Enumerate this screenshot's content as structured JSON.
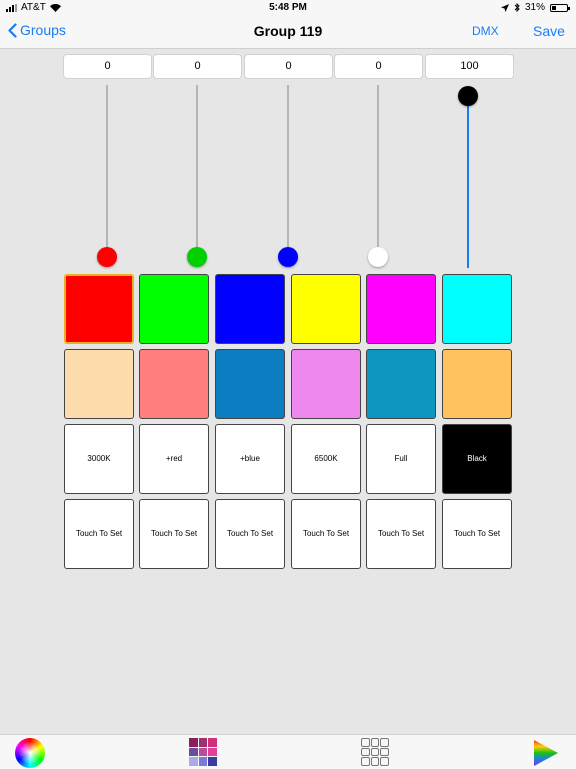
{
  "status_bar": {
    "carrier": "AT&T",
    "time": "5:48 PM",
    "battery": "31%",
    "battery_level": 0.31
  },
  "nav": {
    "back_label": "Groups",
    "title": "Group 119",
    "dmx_label": "DMX",
    "save_label": "Save"
  },
  "channels": [
    {
      "value": "0",
      "level": 0,
      "knob_color": "#ff0000"
    },
    {
      "value": "0",
      "level": 0,
      "knob_color": "#00d000"
    },
    {
      "value": "0",
      "level": 0,
      "knob_color": "#0000ff"
    },
    {
      "value": "0",
      "level": 0,
      "knob_color": "#ffffff"
    },
    {
      "value": "100",
      "level": 1,
      "knob_color": "#000000"
    }
  ],
  "color_swatches_row1": [
    {
      "color": "#ff0000",
      "selected": true
    },
    {
      "color": "#00ff00",
      "selected": false
    },
    {
      "color": "#0000ff",
      "selected": false
    },
    {
      "color": "#ffff00",
      "selected": false
    },
    {
      "color": "#ff00ff",
      "selected": false
    },
    {
      "color": "#00ffff",
      "selected": false
    }
  ],
  "color_swatches_row2": [
    {
      "color": "#ffdcac"
    },
    {
      "color": "#ff7f7f"
    },
    {
      "color": "#0b7dc0"
    },
    {
      "color": "#ee88ee"
    },
    {
      "color": "#0d96bf"
    },
    {
      "color": "#ffc25c"
    }
  ],
  "presets": [
    {
      "label": "3000K",
      "color": "#ffffff"
    },
    {
      "label": "+red",
      "color": "#ffffff"
    },
    {
      "label": "+blue",
      "color": "#ffffff"
    },
    {
      "label": "6500K",
      "color": "#ffffff"
    },
    {
      "label": "Full",
      "color": "#ffffff"
    },
    {
      "label": "Black",
      "color": "#000000"
    }
  ],
  "touch_to_set": [
    {
      "label": "Touch To Set"
    },
    {
      "label": "Touch To Set"
    },
    {
      "label": "Touch To Set"
    },
    {
      "label": "Touch To Set"
    },
    {
      "label": "Touch To Set"
    },
    {
      "label": "Touch To Set"
    }
  ],
  "toolbar": {
    "color_wheel_icon": "color-wheel-icon",
    "palette_icon": "palette-grid-icon",
    "grid_icon": "grid-icon",
    "play_icon": "play-spectrum-icon",
    "palette_colors": [
      "#8a1f5e",
      "#a0306e",
      "#d0307a",
      "#6d4c9a",
      "#c04a9a",
      "#e0409a",
      "#a9a9ee",
      "#7a7ad8",
      "#3a3aa0"
    ],
    "accent": "#1a7cf5"
  }
}
